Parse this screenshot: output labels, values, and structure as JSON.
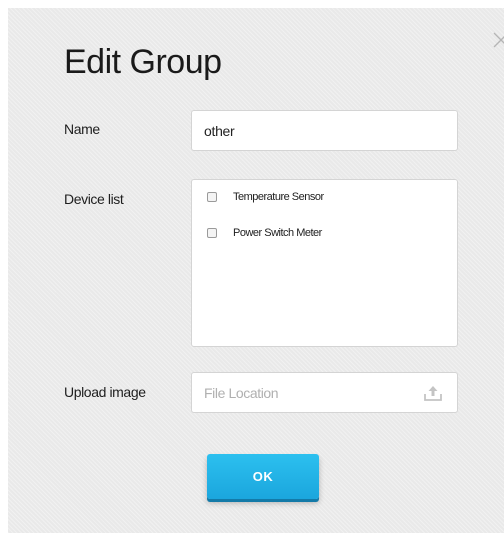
{
  "dialog": {
    "title": "Edit Group",
    "close_icon": "close-icon"
  },
  "form": {
    "name_label": "Name",
    "name_value": "other",
    "device_list_label": "Device list",
    "devices": [
      {
        "label": "Temperature Sensor",
        "checked": false
      },
      {
        "label": "Power Switch Meter",
        "checked": false
      }
    ],
    "upload_label": "Upload image",
    "upload_placeholder": "File Location",
    "upload_icon": "upload-icon"
  },
  "actions": {
    "ok_label": "OK"
  },
  "colors": {
    "dialog_bg": "#e9e9e9",
    "button_bg": "#1ba6dd",
    "button_text": "#ffffff"
  }
}
